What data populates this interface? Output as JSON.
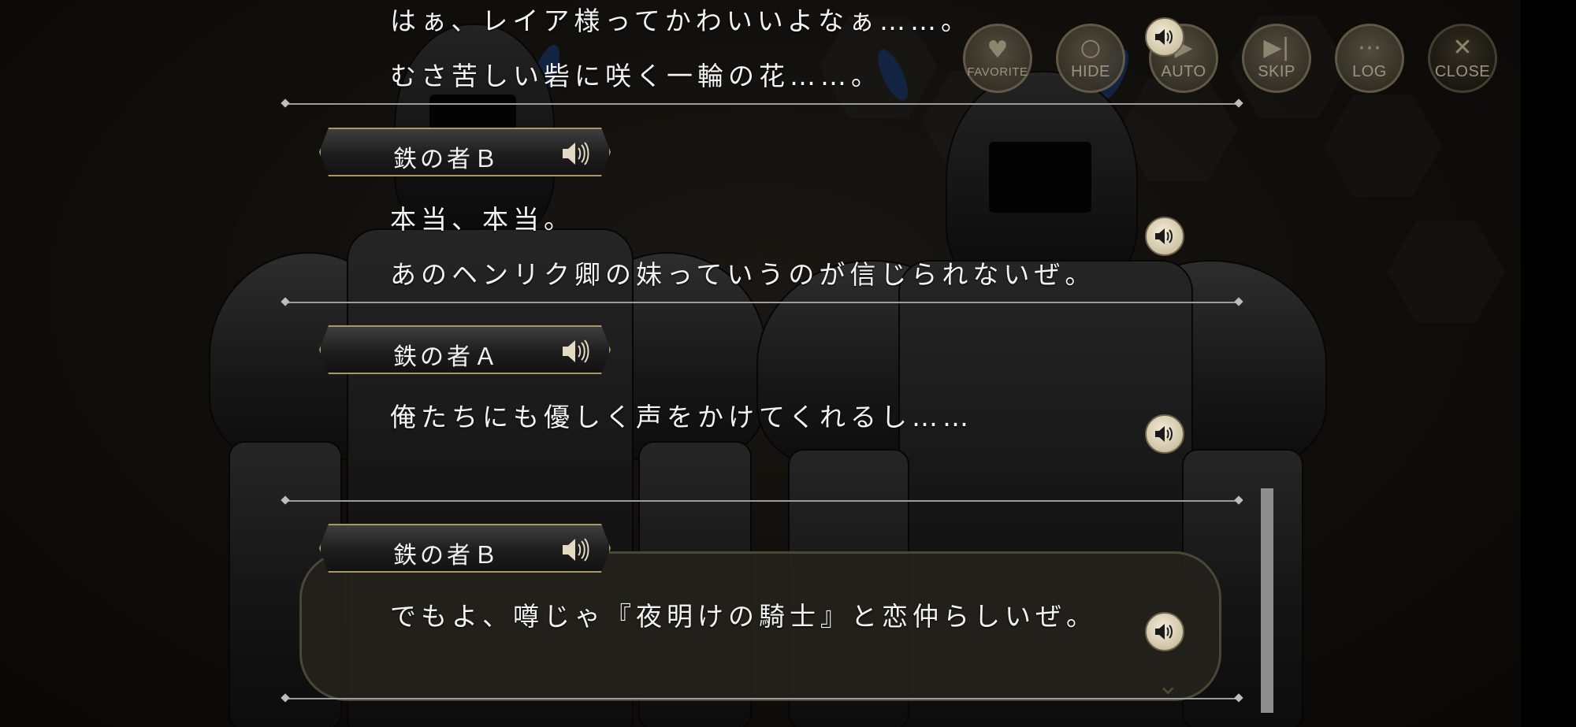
{
  "toolbar": {
    "buttons": [
      {
        "label": "FAVORITE",
        "icon": "heart-icon"
      },
      {
        "label": "HIDE",
        "icon": "eye-slash-icon"
      },
      {
        "label": "AUTO",
        "icon": "auto-play-icon"
      },
      {
        "label": "SKIP",
        "icon": "skip-icon"
      },
      {
        "label": "LOG",
        "icon": "speech-bubble-icon"
      },
      {
        "label": "CLOSE",
        "icon": "close-icon"
      }
    ]
  },
  "log": {
    "entries": [
      {
        "speaker": "",
        "lines": [
          "はぁ、レイア様ってかわいいよなぁ……。",
          "むさ苦しい砦に咲く一輪の花……。"
        ]
      },
      {
        "speaker": "鉄の者Ｂ",
        "lines": [
          "本当、本当。",
          "あのヘンリク卿の妹っていうのが信じられないぜ。"
        ]
      },
      {
        "speaker": "鉄の者Ａ",
        "lines": [
          "俺たちにも優しく声をかけてくれるし……"
        ]
      },
      {
        "speaker": "鉄の者Ｂ",
        "lines": [
          "でもよ、噂じゃ『夜明けの騎士』と恋仲らしいぜ。"
        ]
      }
    ]
  },
  "colors": {
    "text": "#f3f3f3",
    "nameplate_border": "#a99765",
    "voice_button": "#e9dfc6",
    "divider": "#9c9c9c"
  }
}
